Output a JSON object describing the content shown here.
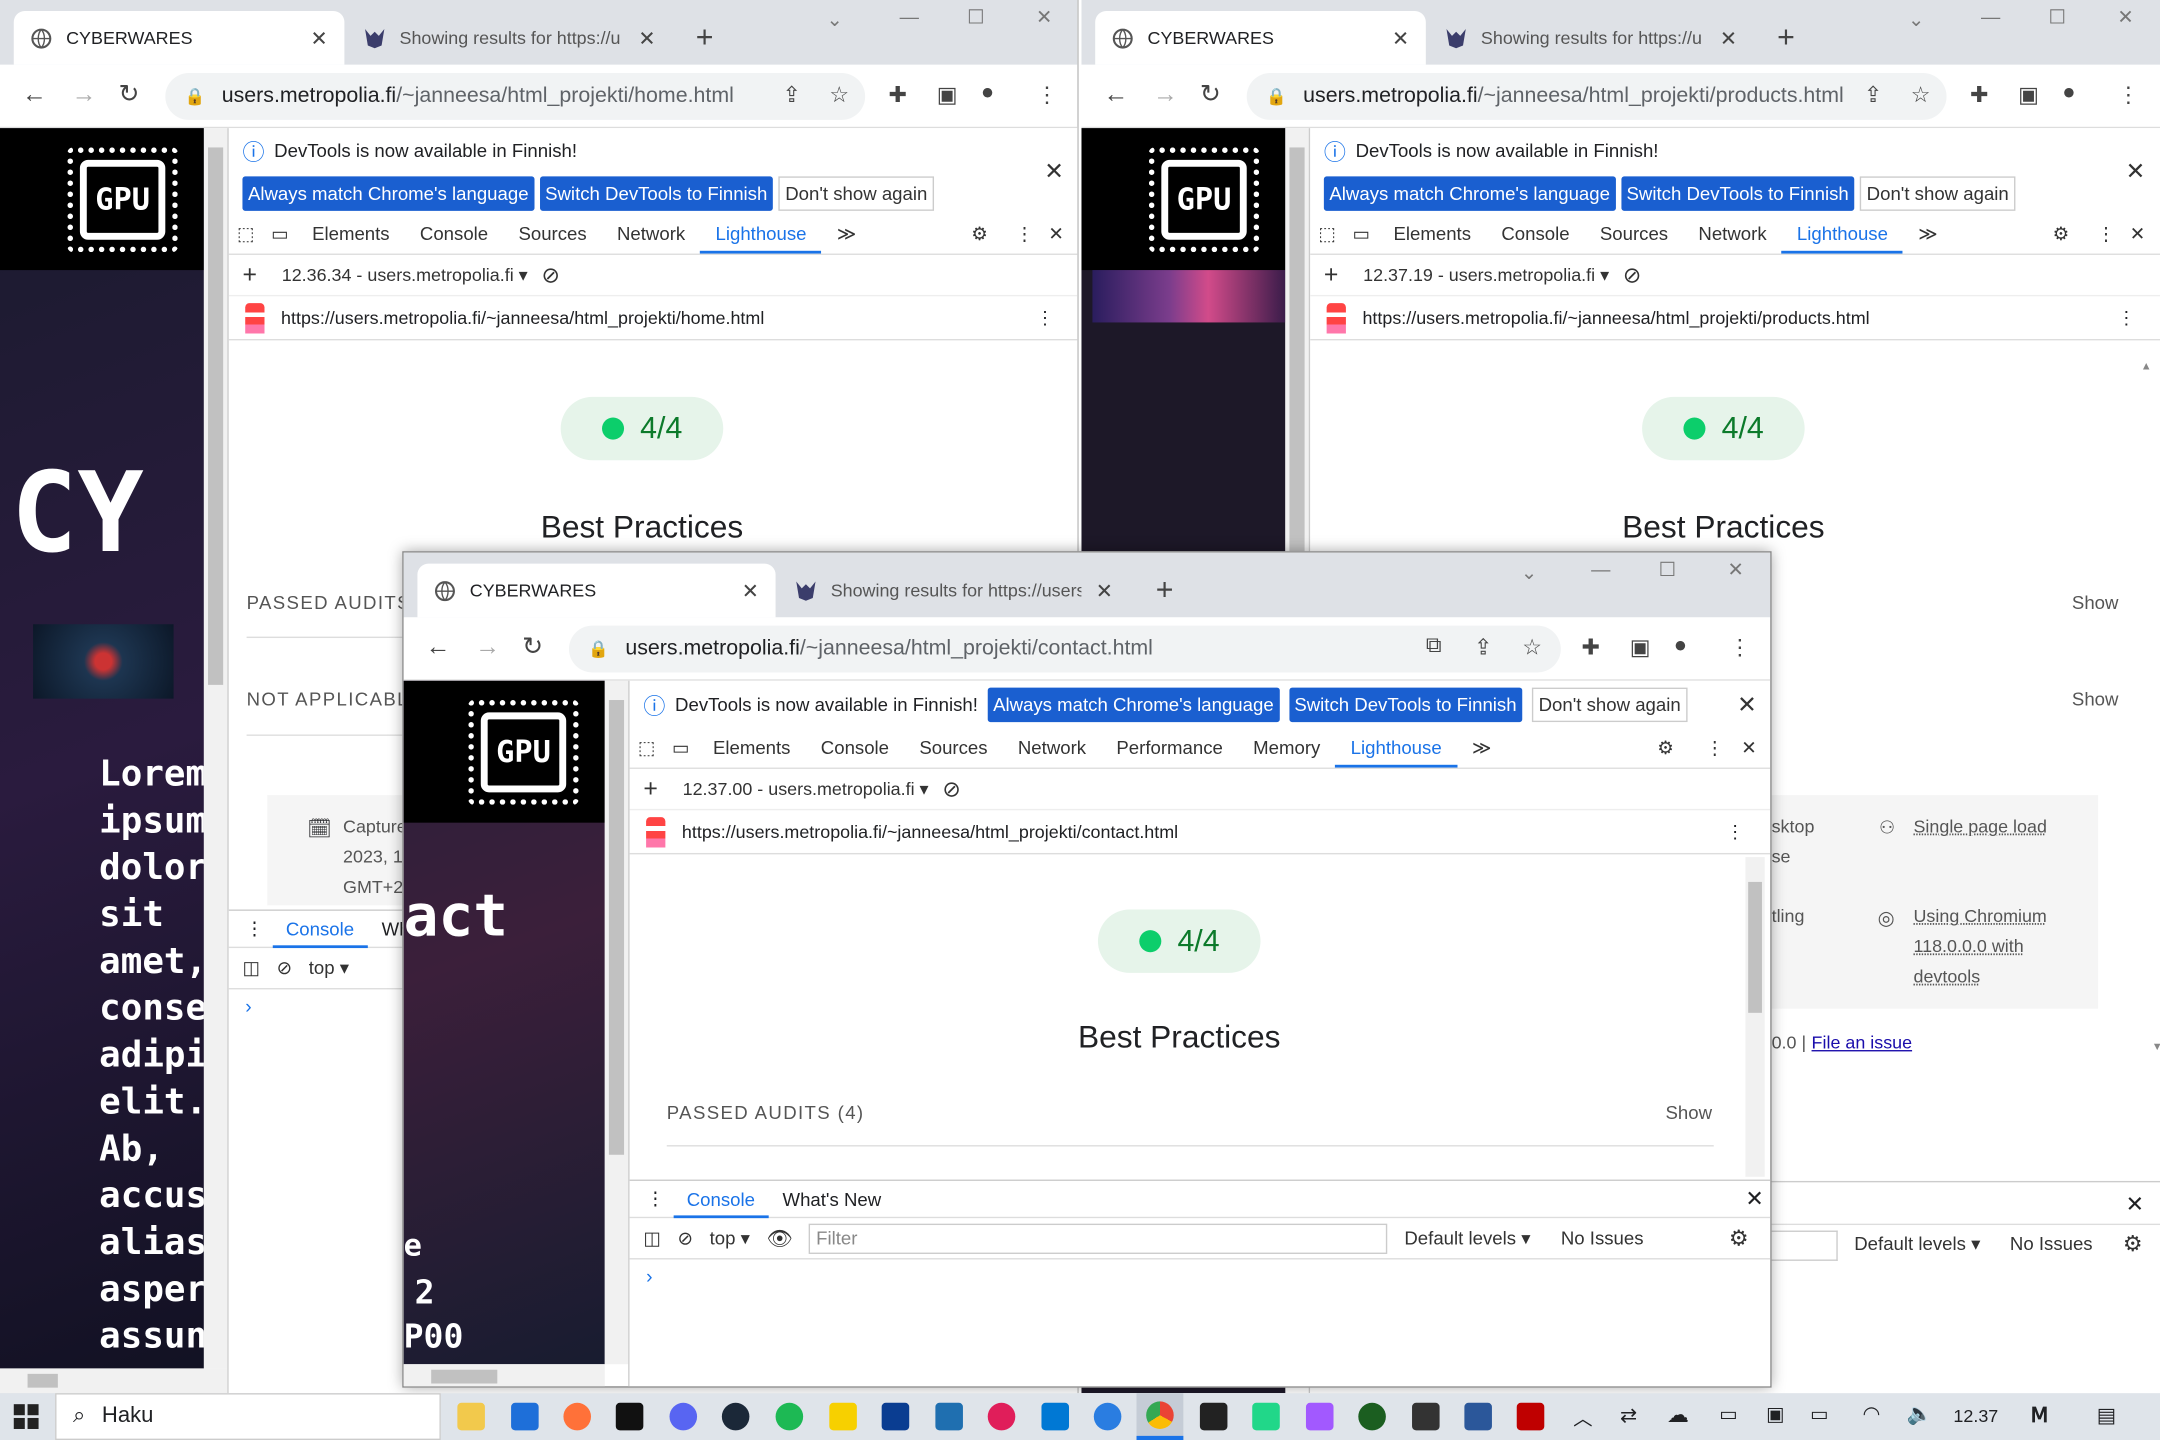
{
  "left_window": {
    "tab1_title": "CYBERWARES",
    "tab2_title": "Showing results for https://u",
    "address_host": "users.metropolia.fi",
    "address_path": "/~janneesa/html_projekti/home.html",
    "site_logo": "GPU",
    "site_heading": "CY",
    "site_lorem": "Lorem\nipsum\ndolor\nsit\namet,\nconse\nadipis\nelit.\nAb,\naccus\nalias\nasper\nassun",
    "devtools_info": "DevTools is now available in Finnish!",
    "btn_match": "Always match Chrome's language",
    "btn_switch": "Switch DevTools to Finnish",
    "btn_dont": "Don't show again",
    "panels": [
      "Elements",
      "Console",
      "Sources",
      "Network",
      "Lighthouse"
    ],
    "report_select": "12.36.34 - users.metropolia.fi",
    "report_url": "https://users.metropolia.fi/~janneesa/html_projekti/home.html",
    "score": "4/4",
    "category": "Best Practices",
    "passed": "PASSED AUDITS",
    "not_applicable": "NOT APPLICABL",
    "capture_lines": [
      "Capture",
      "2023, 1",
      "GMT+2"
    ],
    "console_tab": "Console",
    "whats_new_tab": "Wh",
    "context": "top"
  },
  "right_window": {
    "tab1_title": "CYBERWARES",
    "tab2_title": "Showing results for https://u",
    "address_host": "users.metropolia.fi",
    "address_path": "/~janneesa/html_projekti/products.html",
    "site_logo": "GPU",
    "devtools_info": "DevTools is now available in Finnish!",
    "btn_match": "Always match Chrome's language",
    "btn_switch": "Switch DevTools to Finnish",
    "btn_dont": "Don't show again",
    "panels": [
      "Elements",
      "Console",
      "Sources",
      "Network",
      "Lighthouse"
    ],
    "report_select": "12.37.19 - users.metropolia.fi",
    "report_url": "https://users.metropolia.fi/~janneesa/html_projekti/products.html",
    "score": "4/4",
    "category": "Best Practices",
    "show1": "Show",
    "show2": "Show",
    "env_desktop": "sktop",
    "env_desktop2": "se",
    "env_single": "Single page load",
    "env_throttle": "tling",
    "env_chromium": [
      "Using Chromium",
      "118.0.0.0 with",
      "devtools"
    ],
    "version_suffix": "0.0 |",
    "file_issue": "File an issue",
    "default_levels": "Default levels",
    "no_issues": "No Issues"
  },
  "front_window": {
    "tab1_title": "CYBERWARES",
    "tab2_title": "Showing results for https://users",
    "address_host": "users.metropolia.fi",
    "address_path": "/~janneesa/html_projekti/contact.html",
    "site_logo": "GPU",
    "site_heading": "act",
    "site_text1": "e",
    "site_text2": "2",
    "site_text3": "P00",
    "devtools_info": "DevTools is now available in Finnish!",
    "btn_match": "Always match Chrome's language",
    "btn_switch": "Switch DevTools to Finnish",
    "btn_dont": "Don't show again",
    "panels": [
      "Elements",
      "Console",
      "Sources",
      "Network",
      "Performance",
      "Memory",
      "Lighthouse"
    ],
    "report_select": "12.37.00 - users.metropolia.fi",
    "report_url": "https://users.metropolia.fi/~janneesa/html_projekti/contact.html",
    "score": "4/4",
    "category": "Best Practices",
    "passed": "PASSED AUDITS (4)",
    "show": "Show",
    "console_tab": "Console",
    "whats_new_tab": "What's New",
    "context": "top",
    "filter_placeholder": "Filter",
    "default_levels": "Default levels",
    "no_issues": "No Issues"
  },
  "taskbar": {
    "search": "Haku",
    "clock": "12.37"
  },
  "colors": {
    "accent": "#1a73e8",
    "infobar_button": "#1a5fd0",
    "score_green": "#0cce6b",
    "site_bg": "#151626",
    "tabstrip": "#dee1e6"
  }
}
